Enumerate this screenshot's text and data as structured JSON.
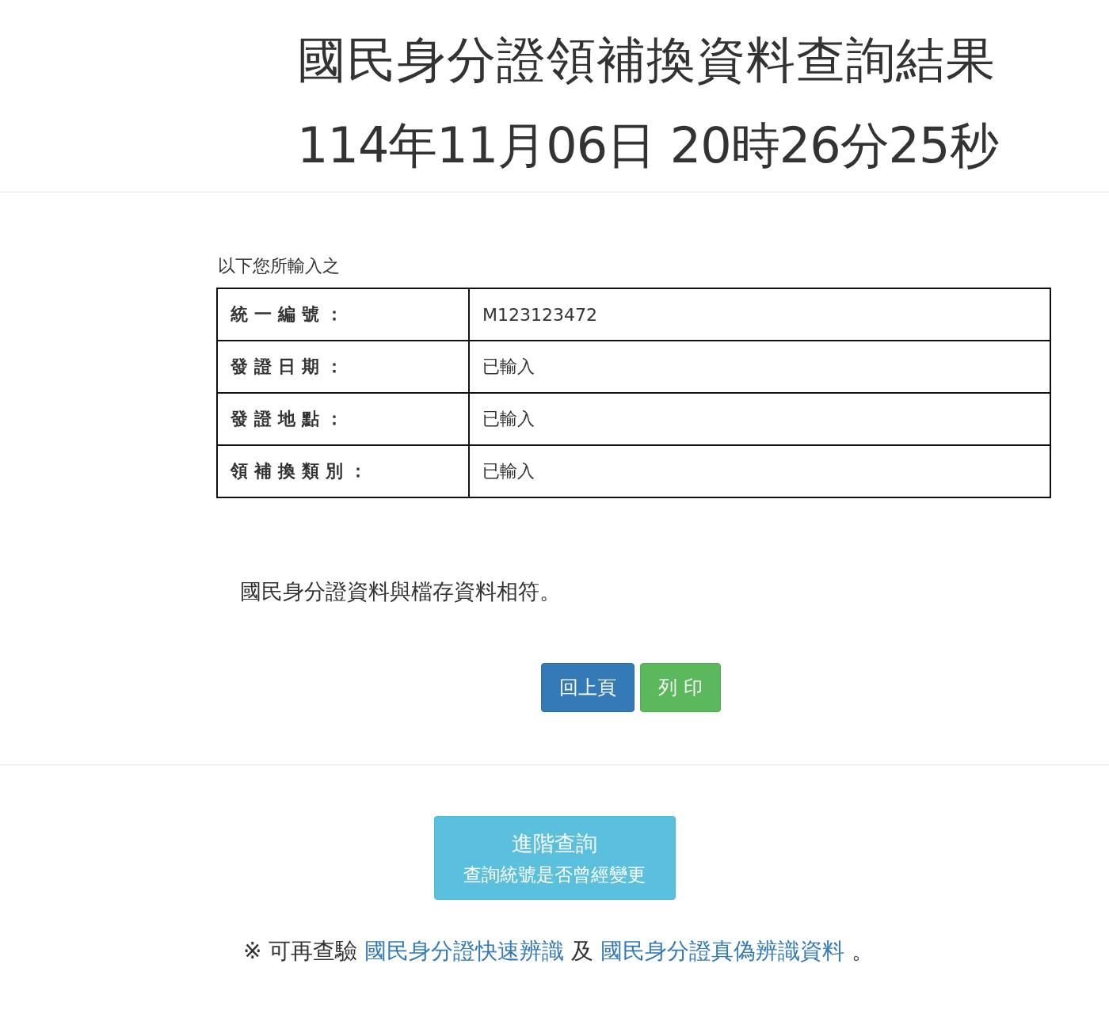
{
  "title": {
    "line_1": "國民身分證領補換資料查詢結果",
    "line_2": "114年11月06日 20時26分25秒"
  },
  "intro": "以下您所輸入之",
  "table": {
    "rows": [
      {
        "label": "統一編號：",
        "value": "M123123472"
      },
      {
        "label": "發證日期：",
        "value": "已輸入"
      },
      {
        "label": "發證地點：",
        "value": "已輸入"
      },
      {
        "label": "領補換類別：",
        "value": "已輸入"
      }
    ]
  },
  "message": "國民身分證資料與檔存資料相符。",
  "buttons": [
    {
      "label": "回上頁",
      "kind": "primary"
    },
    {
      "label": "列 印",
      "kind": "success"
    }
  ],
  "advanced": {
    "title": "進階查詢",
    "subtitle": "查詢統號是否曾經變更"
  },
  "footer": {
    "prefix": "※ 可再查驗",
    "link_1": "國民身分證快速辨識",
    "middle": "及",
    "link_2": "國民身分證真偽辨識資料",
    "suffix": "。"
  }
}
